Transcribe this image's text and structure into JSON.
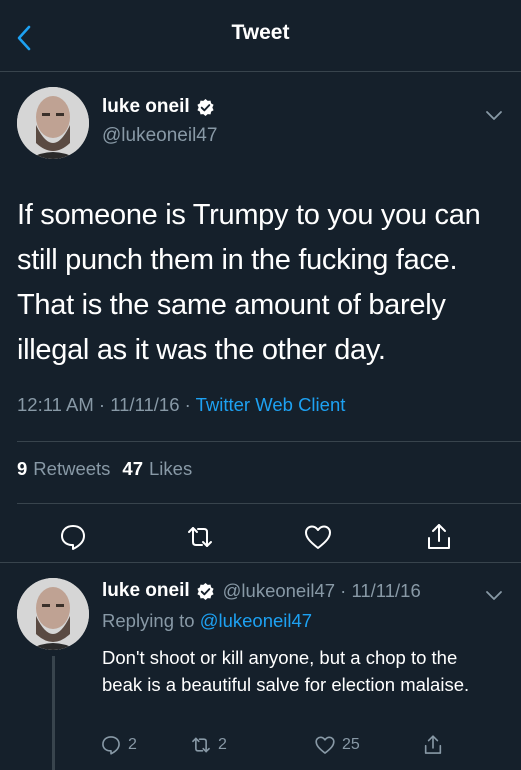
{
  "header": {
    "title": "Tweet"
  },
  "main_tweet": {
    "display_name": "luke oneil",
    "handle": "@lukeoneil47",
    "text": "If someone is Trumpy to you you can still punch them in the fucking face. That is the same amount of barely illegal as it was the other day.",
    "time_date": "12:11 AM · 11/11/16 · ",
    "client": "Twitter Web Client",
    "retweet_count": "9",
    "retweet_label": "Retweets",
    "like_count": "47",
    "like_label": "Likes"
  },
  "reply_tweet": {
    "display_name": "luke oneil",
    "handle_date": "@lukeoneil47 · 11/11/16",
    "replying_prefix": "Replying to ",
    "replying_to": "@lukeoneil47",
    "text": "Don't shoot or kill anyone, but a chop to the beak is a beautiful salve for election malaise.",
    "reply_count": "2",
    "retweet_count": "2",
    "like_count": "25"
  },
  "icons": {
    "back": "chevron-left-icon",
    "verified": "verified-badge-icon",
    "more": "chevron-down-icon",
    "reply": "comment-icon",
    "retweet": "retweet-icon",
    "like": "heart-icon",
    "share": "share-icon"
  },
  "colors": {
    "background": "#15202b",
    "accent": "#1da1f2",
    "secondary_text": "#8899a6",
    "divider": "#38444d"
  }
}
